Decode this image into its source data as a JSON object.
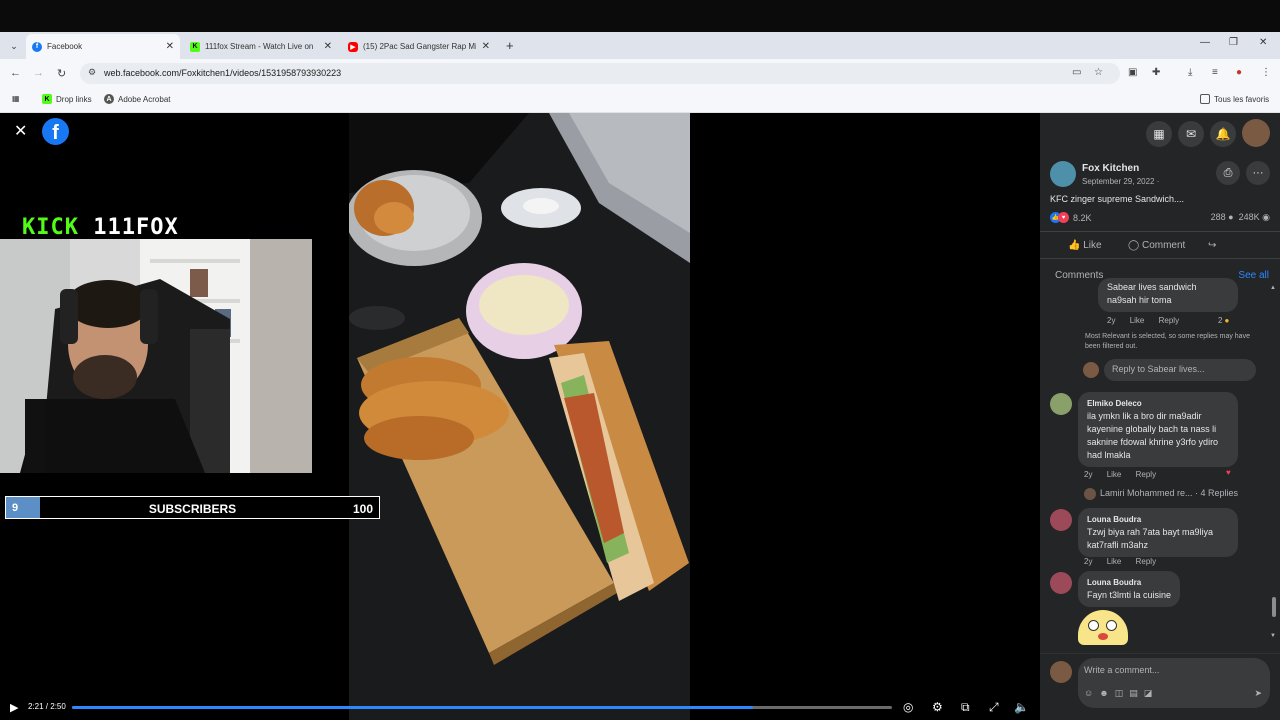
{
  "browser": {
    "tabs": [
      {
        "title": "Facebook",
        "favicon": "facebook-icon",
        "color": "#1877f2"
      },
      {
        "title": "111fox Stream - Watch Live on",
        "favicon": "kick-icon",
        "color": "#53fc18"
      },
      {
        "title": "(15) 2Pac Sad Gangster Rap Mi",
        "favicon": "youtube-icon",
        "color": "#ff0000"
      }
    ],
    "url": "web.facebook.com/Foxkitchen1/videos/1531958793930223",
    "bookmarks": [
      {
        "label": "Drop links",
        "icon": "kick-icon"
      },
      {
        "label": "Adobe Acrobat",
        "icon": "acrobat-icon"
      }
    ],
    "all_bookmarks": "Tous les favoris"
  },
  "overlay": {
    "kick_word": "KICK",
    "channel": "111FOX",
    "subscribers_label": "SUBSCRIBERS",
    "subscribers_current": "9",
    "subscribers_goal": "100",
    "subscribers_progress": 0.09
  },
  "player": {
    "time": "2:21 / 2:50",
    "progress": 0.83
  },
  "post": {
    "page_name": "Fox Kitchen",
    "date": "September 29, 2022 ·",
    "text": "KFC zinger supreme Sandwich....",
    "reactions": "8.2K",
    "comments_count": "288",
    "views": "248K",
    "like_label": "Like",
    "comment_label": "Comment"
  },
  "comments": {
    "header": "Comments",
    "see_all": "See all",
    "c0": {
      "text1": "Sabear lives sandwich",
      "text2": "na9sah hir toma",
      "age": "2y",
      "like": "Like",
      "reply": "Reply",
      "count": "2"
    },
    "note": "Most Relevant is selected, so some replies may have been filtered out.",
    "reply_placeholder": "Reply to Sabear lives...",
    "c1": {
      "name": "Elmiko Deleco",
      "l1": "ila ymkn lik a bro dir ma9adir",
      "l2": "kayenine globally bach ta nass li",
      "l3": "saknine fdowal khrine y3rfo ydiro",
      "l4": "had lmakla",
      "age": "2y",
      "like": "Like",
      "reply": "Reply"
    },
    "c1_replies": "Lamiri Mohammed re... · 4 Replies",
    "c2": {
      "name": "Louna Boudra",
      "l1": "Tzwj biya rah 7ata bayt ma9liya",
      "l2": "kat7rafli m3ahz",
      "age": "2y",
      "like": "Like",
      "reply": "Reply"
    },
    "c3": {
      "name": "Louna Boudra",
      "l1": "Fayn t3lmti la cuisine"
    },
    "write_placeholder": "Write a comment..."
  }
}
